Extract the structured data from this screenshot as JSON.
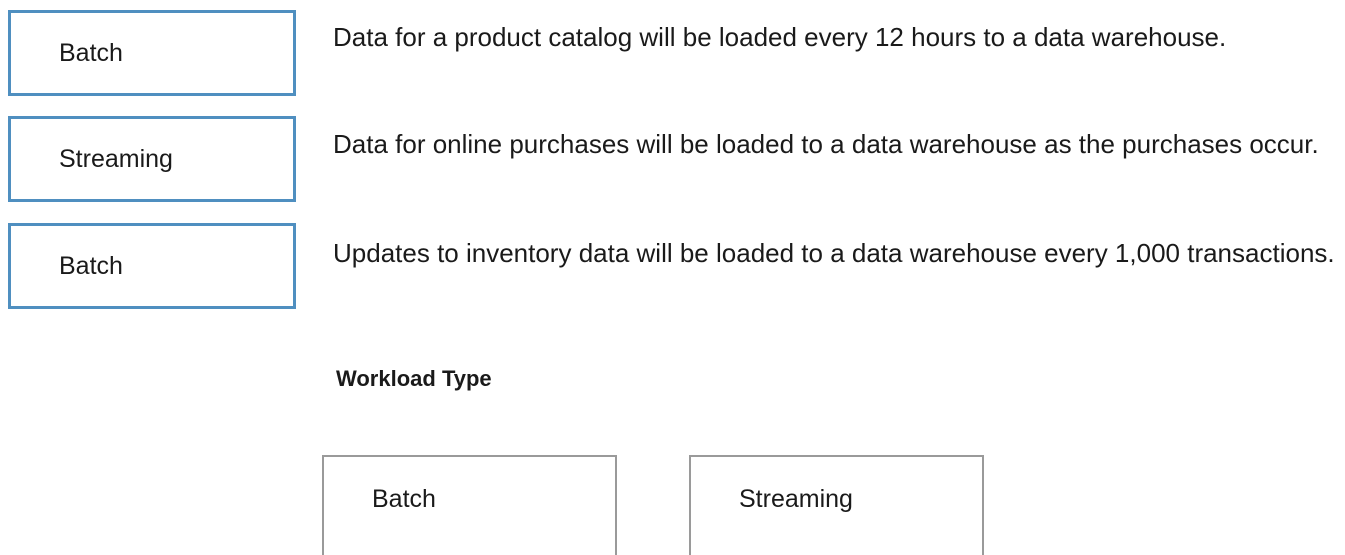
{
  "answers": [
    {
      "label": "Batch"
    },
    {
      "label": "Streaming"
    },
    {
      "label": "Batch"
    }
  ],
  "statements": [
    "Data for a product catalog will be loaded every 12 hours to a data warehouse.",
    "Data for online purchases will be loaded to a data warehouse as the purchases occur.",
    "Updates to inventory data will be loaded to a data warehouse every 1,000 transactions."
  ],
  "workload_type": {
    "title": "Workload Type",
    "options": [
      "Batch",
      "Streaming"
    ]
  },
  "colors": {
    "answer_border": "#4f8fc0",
    "option_border": "#9a9a9a",
    "text": "#1a1a1a"
  }
}
